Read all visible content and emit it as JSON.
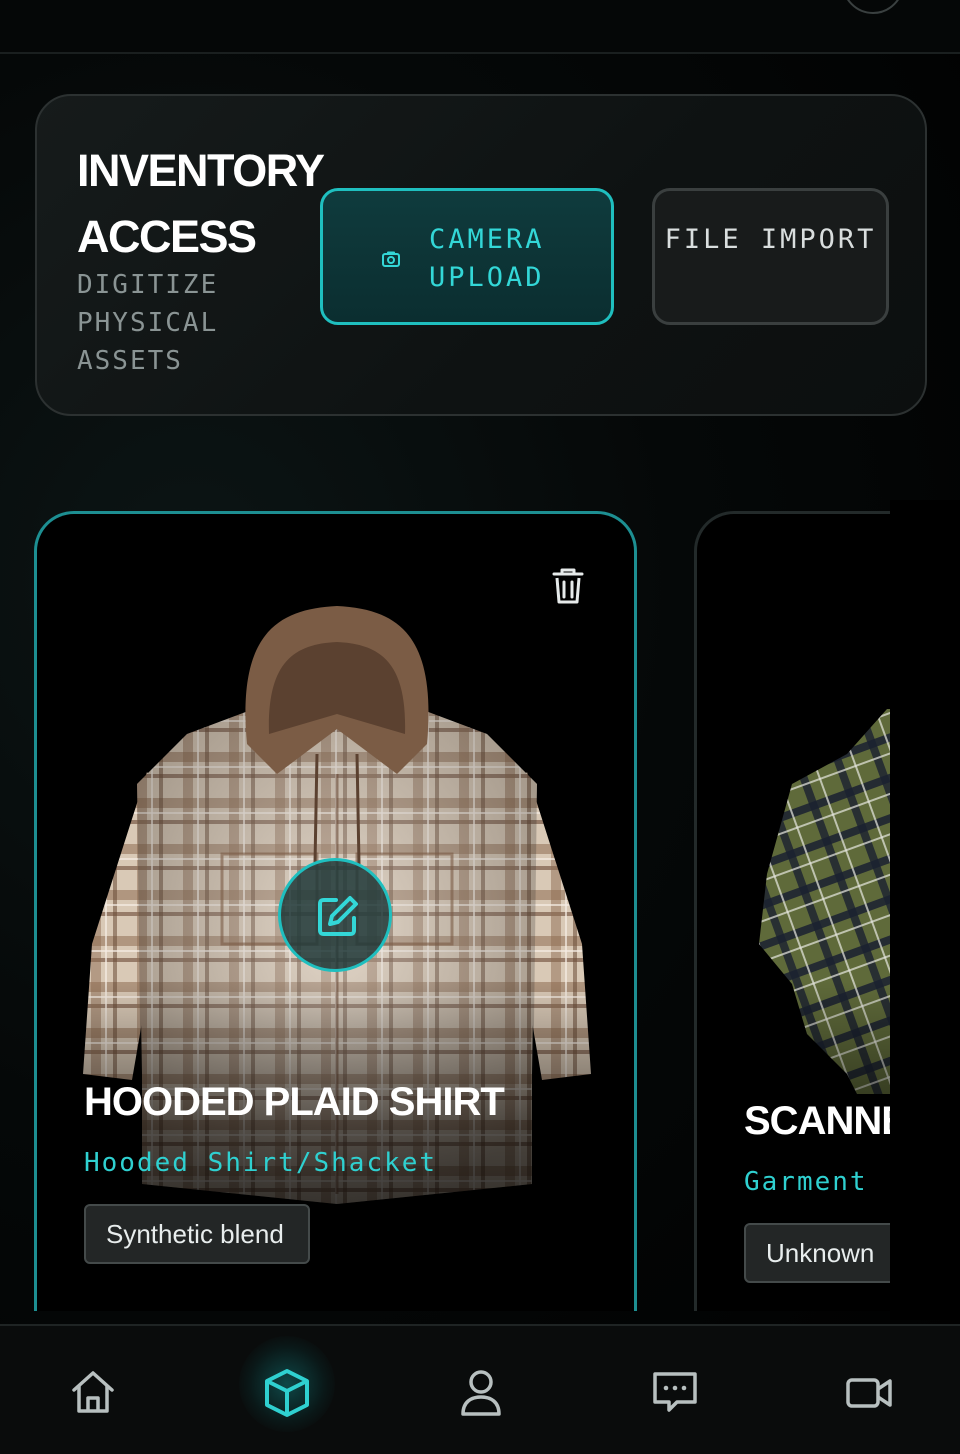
{
  "colors": {
    "accent": "#1fbfbf",
    "accent_text": "#33d7d7",
    "background": "#000000",
    "panel": "#121717",
    "muted_text": "#8a9494"
  },
  "inventory": {
    "title": "INVENTORY ACCESS",
    "subtitle": "DIGITIZE PHYSICAL ASSETS",
    "camera_button": {
      "icon": "camera-icon",
      "label": "CAMERA UPLOAD"
    },
    "file_button": {
      "label": "FILE IMPORT"
    }
  },
  "cards": [
    {
      "title": "HOODED PLAID SHIRT",
      "type": "Hooded Shirt/Shacket",
      "material": "Synthetic blend",
      "image": "beige-plaid-hooded-shirt",
      "icons": [
        "trash-icon",
        "edit-icon"
      ]
    },
    {
      "title": "SCANNE",
      "type": "Garment",
      "material": "Unknown",
      "image": "green-plaid-shirt"
    }
  ],
  "bottom_nav": {
    "items": [
      {
        "icon": "home-icon",
        "active": false
      },
      {
        "icon": "cube-icon",
        "active": true
      },
      {
        "icon": "user-icon",
        "active": false
      },
      {
        "icon": "chat-icon",
        "active": false
      },
      {
        "icon": "video-icon",
        "active": false
      }
    ]
  }
}
